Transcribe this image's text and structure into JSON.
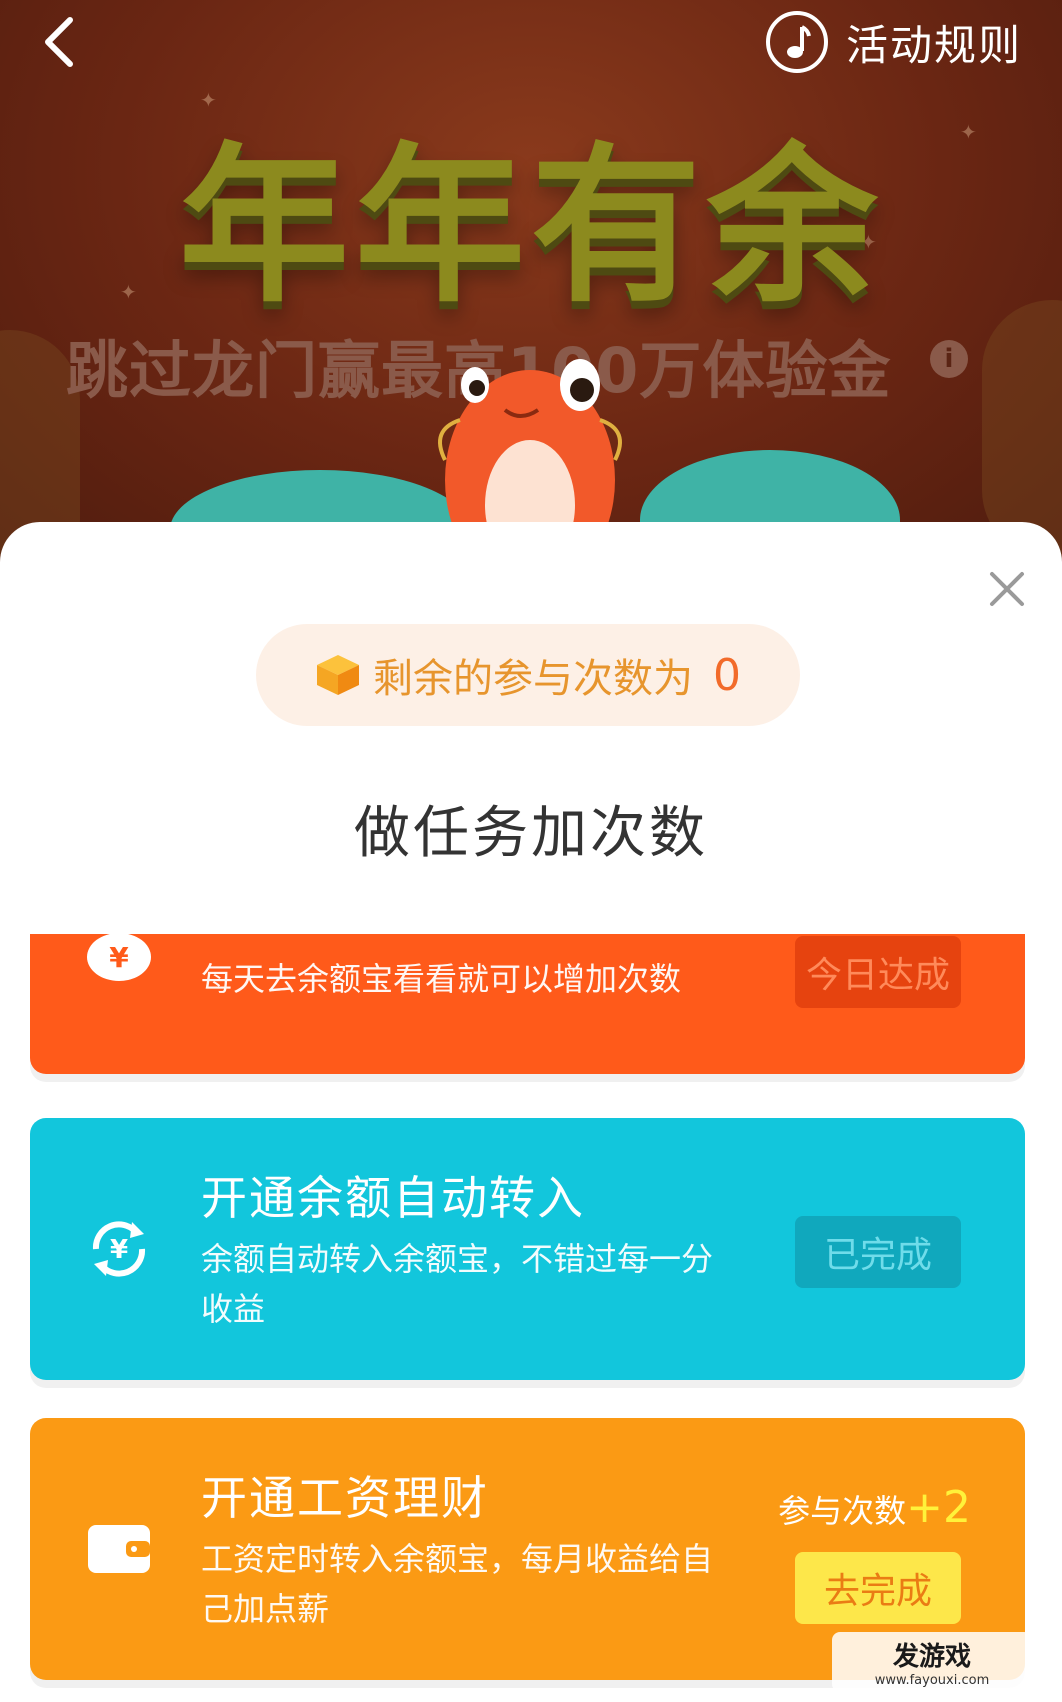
{
  "header": {
    "back_icon": "chevron-left-icon",
    "rules_icon": "music-note-icon",
    "rules_label": "活动规则"
  },
  "banner": {
    "title": "年年有余",
    "subtitle": "跳过龙门赢最高100万体验金",
    "info_icon": "info-icon"
  },
  "modal": {
    "close_icon": "close-icon",
    "remaining_label": "剩余的参与次数为",
    "remaining_count": "0",
    "section_title": "做任务加次数",
    "tasks": [
      {
        "icon": "yuan-bag-icon",
        "name": "",
        "desc": "每天去余额宝看看就可以增加次数",
        "button": "今日达成",
        "color": "#ff5a1a"
      },
      {
        "icon": "yuan-refresh-icon",
        "name": "开通余额自动转入",
        "desc": "余额自动转入余额宝，不错过每一分收益",
        "button": "已完成",
        "color": "#12c6dc"
      },
      {
        "icon": "wallet-icon",
        "name": "开通工资理财",
        "desc": "工资定时转入余额宝，每月收益给自己加点薪",
        "bonus_label": "参与次数",
        "bonus_value": "+2",
        "button": "去完成",
        "color": "#fb9a14"
      }
    ]
  },
  "watermark": {
    "main": "发游戏",
    "sub": "www.fayouxi.com"
  }
}
